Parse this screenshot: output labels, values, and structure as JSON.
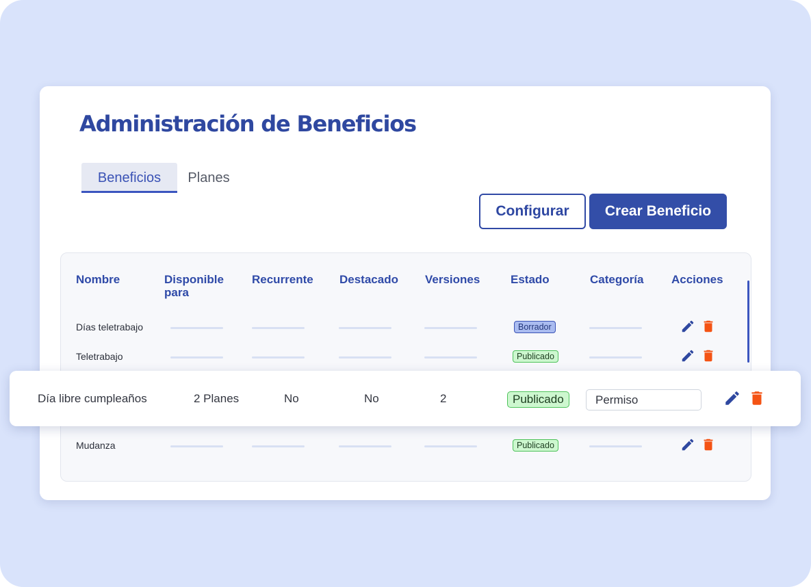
{
  "page": {
    "title": "Administración de Beneficios",
    "tabs": [
      {
        "label": "Beneficios",
        "active": true
      },
      {
        "label": "Planes",
        "active": false
      }
    ],
    "buttons": {
      "configure": "Configurar",
      "create": "Crear Beneficio"
    }
  },
  "table": {
    "headers": [
      "Nombre",
      "Disponible para",
      "Recurrente",
      "Destacado",
      "Versiones",
      "Estado",
      "Categoría",
      "Acciones"
    ],
    "rows": [
      {
        "name": "Días teletrabajo",
        "status": "Borrador"
      },
      {
        "name": "Teletrabajo",
        "status": "Publicado"
      },
      {
        "name": "Mudanza",
        "status": "Publicado"
      }
    ]
  },
  "highlighted_row": {
    "name": "Día libre cumpleaños",
    "available_for": "2 Planes",
    "recurring": "No",
    "featured": "No",
    "versions": "2",
    "status": "Publicado",
    "category": "Permiso"
  },
  "colors": {
    "primary": "#334ea8",
    "background": "#d9e3fb",
    "draft_badge": "#aabcf0",
    "published_badge": "#cdf7cf",
    "delete_icon": "#f45314"
  },
  "icons": [
    "pencil-icon",
    "trash-icon"
  ]
}
